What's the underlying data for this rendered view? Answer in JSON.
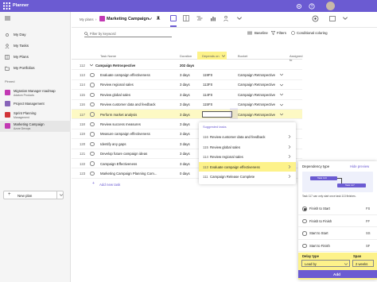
{
  "app": {
    "name": "Planner"
  },
  "colors": {
    "brand": "#6b5bd2",
    "highlight": "#fdf9c4",
    "highlight_strong": "#fdf28a",
    "add_button": "#6b5bd2"
  },
  "sidebar": {
    "nav": [
      {
        "label": "My Day",
        "icon": "sun-icon"
      },
      {
        "label": "My Tasks",
        "icon": "person-icon"
      },
      {
        "label": "My Plans",
        "icon": "grid-icon"
      },
      {
        "label": "My Portfolios",
        "icon": "folder-icon"
      }
    ],
    "pinned_label": "Pinned",
    "plans": [
      {
        "name": "Migration Manager roadmap",
        "sub": "Adatum Products",
        "color": "#c239b3"
      },
      {
        "name": "Project Management",
        "sub": "",
        "color": "#8764b8"
      },
      {
        "name": "Sprint Planning",
        "sub": "Management",
        "color": "#d13438"
      },
      {
        "name": "Marketing Campaign",
        "sub": "Azure Devops",
        "color": "#c239b3"
      }
    ],
    "new_plan": "New plan"
  },
  "header": {
    "breadcrumb_root": "My plans",
    "title": "Marketing Campaign",
    "search_placeholder": "Filter by keyword",
    "baseline": "Baseline",
    "filters": "Filters",
    "conditional": "Conditional coloring"
  },
  "columns": {
    "task_name": "Task Name",
    "duration": "Duration",
    "depends_on": "Depends on",
    "bucket": "Bucket",
    "assigned_to": "Assigned to"
  },
  "rows": [
    {
      "num": "112",
      "name": "Campaign Retrospective",
      "duration": "202 days",
      "depends": "",
      "bucket": "",
      "summary": true,
      "hl": false
    },
    {
      "num": "113",
      "name": "Evaluate campaign effectiveness",
      "duration": "3 days",
      "depends": "119FS",
      "bucket": "Campaign Retrospective",
      "summary": false,
      "hl": false
    },
    {
      "num": "114",
      "name": "Review regional sales",
      "duration": "3 days",
      "depends": "113FS",
      "bucket": "Campaign Retrospective",
      "summary": false,
      "hl": false
    },
    {
      "num": "115",
      "name": "Review global sales",
      "duration": "3 days",
      "depends": "114FS",
      "bucket": "Campaign Retrospective",
      "summary": false,
      "hl": false
    },
    {
      "num": "116",
      "name": "Review customer data and feedback",
      "duration": "3 days",
      "depends": "115FS",
      "bucket": "Campaign Retrospective",
      "summary": false,
      "hl": false
    },
    {
      "num": "117",
      "name": "Perform market analysis",
      "duration": "3 days",
      "depends": "",
      "bucket": "Campaign Retrospective",
      "summary": false,
      "hl": true
    },
    {
      "num": "118",
      "name": "Review success measures",
      "duration": "3 days",
      "depends": "",
      "bucket": "",
      "summary": false,
      "hl": false
    },
    {
      "num": "119",
      "name": "Measure campaign effectiveness",
      "duration": "3 days",
      "depends": "",
      "bucket": "",
      "summary": false,
      "hl": false
    },
    {
      "num": "120",
      "name": "Identify any gaps",
      "duration": "3 days",
      "depends": "",
      "bucket": "",
      "summary": false,
      "hl": false
    },
    {
      "num": "121",
      "name": "Develop future campaign ideas",
      "duration": "3 days",
      "depends": "",
      "bucket": "",
      "summary": false,
      "hl": false
    },
    {
      "num": "122",
      "name": "Campaign Effectiveness",
      "duration": "3 days",
      "depends": "",
      "bucket": "",
      "summary": false,
      "hl": false
    },
    {
      "num": "123",
      "name": "Marketing Campaign Planning Com...",
      "duration": "0 days",
      "depends": "",
      "bucket": "",
      "summary": false,
      "hl": false
    }
  ],
  "add_task": "Add new task",
  "suggested": {
    "title": "Suggested tasks",
    "items": [
      {
        "num": "116",
        "name": "Review customer data and feedback",
        "sel": false
      },
      {
        "num": "115",
        "name": "Review global sales",
        "sel": false
      },
      {
        "num": "114",
        "name": "Review regional sales",
        "sel": false
      },
      {
        "num": "113",
        "name": "Evaluate campaign effectiveness",
        "sel": true
      },
      {
        "num": "111",
        "name": "Campaign Release Complete",
        "sel": false
      }
    ]
  },
  "dependency": {
    "title": "Dependency type",
    "hide": "Hide preview",
    "bar_labels": [
      "Task 113",
      "Task 117"
    ],
    "caption": "Task 117 can only start once task 113 finishes.",
    "options": [
      {
        "label": "Finish to Start",
        "code": "FS",
        "on": true
      },
      {
        "label": "Finish to Finish",
        "code": "FF",
        "on": false
      },
      {
        "label": "Start to Start",
        "code": "SS",
        "on": false
      },
      {
        "label": "Start to Finish",
        "code": "SF",
        "on": false
      }
    ],
    "delay_type_label": "Delay type",
    "delay_type_value": "Lead by",
    "span_label": "Span",
    "span_value": "2 weeks",
    "add": "Add"
  }
}
